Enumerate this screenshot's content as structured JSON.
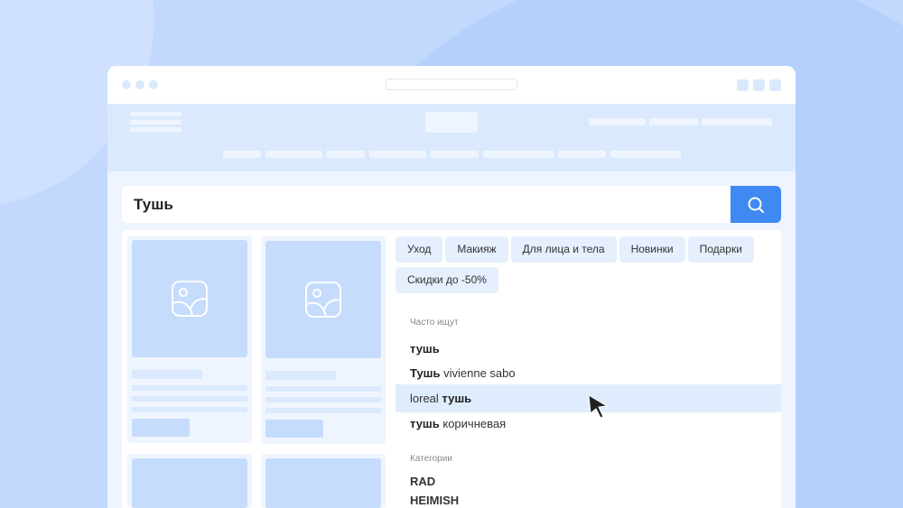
{
  "search": {
    "value": "Тушь"
  },
  "chips": [
    "Уход",
    "Макияж",
    "Для лица и тела",
    "Новинки",
    "Подарки",
    "Скидки до -50%"
  ],
  "frequent": {
    "title": "Часто ищут",
    "items": [
      {
        "pre": "",
        "bold": "тушь",
        "post": ""
      },
      {
        "pre": "",
        "bold": "Тушь",
        "post": " vivienne sabo"
      },
      {
        "pre": "loreal ",
        "bold": "тушь",
        "post": ""
      },
      {
        "pre": "",
        "bold": "тушь",
        "post": " коричневая"
      }
    ]
  },
  "categories": {
    "title": "Категории",
    "items": [
      "RAD",
      "HEIMISH"
    ]
  }
}
